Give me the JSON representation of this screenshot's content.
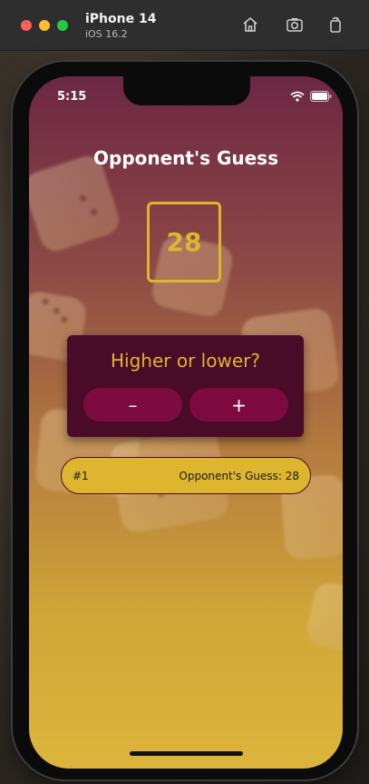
{
  "simulator": {
    "device_name": "iPhone 14",
    "os_version": "iOS 16.2",
    "icons": [
      "home-icon",
      "screenshot-icon",
      "rotate-icon"
    ]
  },
  "status_bar": {
    "time": "5:15",
    "icons": [
      "wifi-icon",
      "battery-icon"
    ]
  },
  "screen": {
    "title": "Opponent's Guess",
    "current_guess": "28",
    "prompt": "Higher or lower?",
    "minus_label": "–",
    "plus_label": "+",
    "log": [
      {
        "round": "#1",
        "text": "Opponent's Guess: 28"
      }
    ]
  },
  "colors": {
    "primary": "#4a0b28",
    "accent": "#ddb52f",
    "button": "#7e0b3f"
  }
}
